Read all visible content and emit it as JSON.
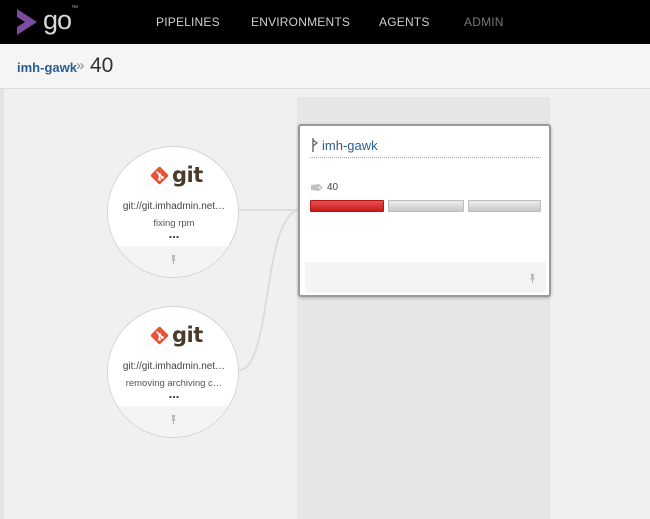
{
  "app": {
    "logo_text": "go",
    "logo_tm": "™"
  },
  "nav": {
    "pipelines": "PIPELINES",
    "environments": "ENVIRONMENTS",
    "agents": "AGENTS",
    "admin": "ADMIN"
  },
  "breadcrumb": {
    "pipeline": "imh-gawk",
    "separator": "»",
    "current": "40"
  },
  "materials": [
    {
      "type_label": "git",
      "url": "git://git.imhadmin.net…",
      "comment": "fixing rpm",
      "more": "..."
    },
    {
      "type_label": "git",
      "url": "git://git.imhadmin.net…",
      "comment": "removing archiving c…",
      "more": "..."
    }
  ],
  "pipeline": {
    "name": "imh-gawk",
    "counter": "40",
    "stages": [
      {
        "status": "failed",
        "color": "#d42a2a"
      },
      {
        "status": "not-run",
        "color": "#d9d9d9"
      },
      {
        "status": "not-run",
        "color": "#d9d9d9"
      }
    ]
  },
  "colors": {
    "topbar": "#000000",
    "link": "#2a5d8f",
    "git_orange": "#f05133",
    "logo_purple": "#7a4b9e",
    "failed": "#d42a2a"
  },
  "icons": {
    "logo": "go-logo-icon",
    "git": "git-diamond-icon",
    "pin": "pin-icon",
    "pipeline": "pipeline-icon",
    "label": "tag-icon"
  }
}
